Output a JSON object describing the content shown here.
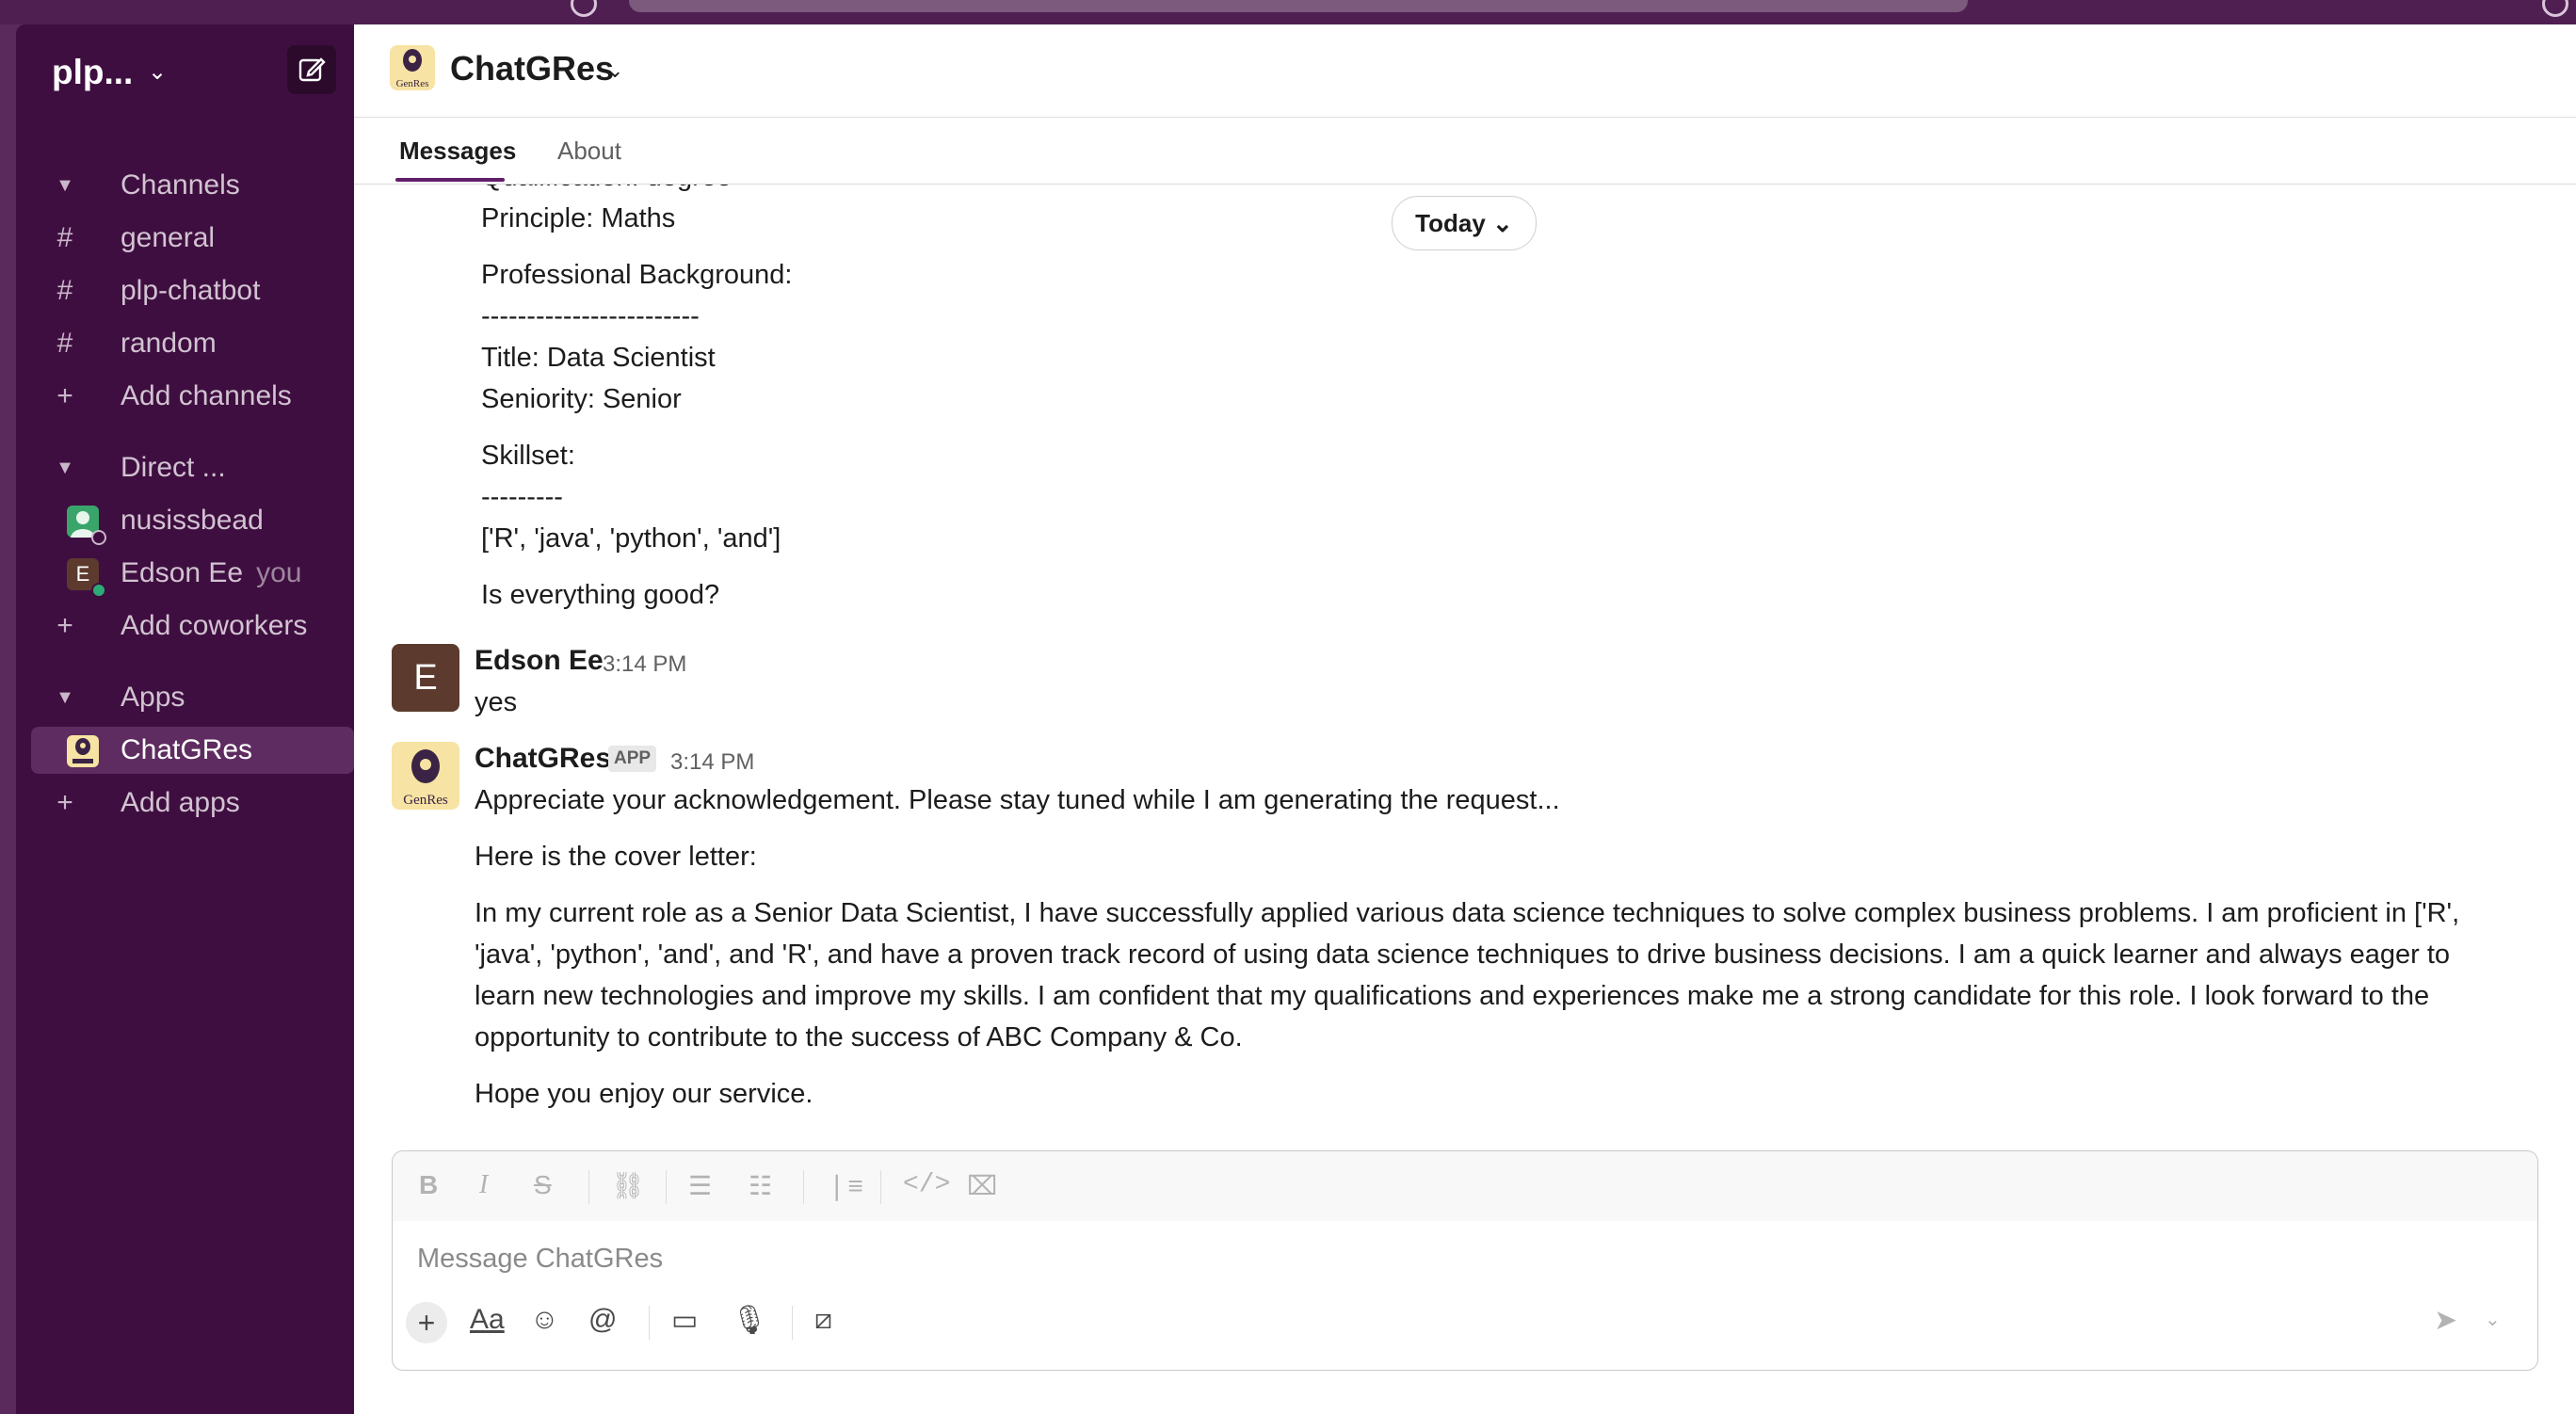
{
  "workspace": {
    "name": "plp..."
  },
  "sidebar": {
    "channels_header": "Channels",
    "channels": [
      "general",
      "plp-chatbot",
      "random"
    ],
    "add_channels": "Add channels",
    "dms_header": "Direct ...",
    "dms": [
      {
        "name": "nusissbead",
        "suffix": ""
      },
      {
        "name": "Edson Ee",
        "suffix": "you",
        "initial": "E"
      }
    ],
    "add_coworkers": "Add coworkers",
    "apps_header": "Apps",
    "apps": [
      "ChatGRes"
    ],
    "add_apps": "Add apps"
  },
  "header": {
    "title": "ChatGRes",
    "logo_text": "GenRes"
  },
  "tabs": [
    "Messages",
    "About"
  ],
  "date_divider": "Today",
  "thread_top": {
    "lines": [
      "Qualification: degree",
      "Principle: Maths",
      "Professional Background:",
      "------------------------",
      "Title: Data Scientist",
      "Seniority: Senior",
      "Skillset:",
      "---------",
      "['R', 'java', 'python', 'and']",
      "Is everything good?"
    ]
  },
  "messages": [
    {
      "author": "Edson Ee",
      "avatar_initial": "E",
      "time": "3:14 PM",
      "text": "yes"
    },
    {
      "author": "ChatGRes",
      "badge": "APP",
      "time": "3:14 PM",
      "paragraphs": [
        "Appreciate your acknowledgement. Please stay tuned while I am generating the request...",
        "Here is the cover letter:",
        "In my current role as a Senior Data Scientist, I have successfully applied various data science techniques to solve complex business problems. I am proficient in ['R', 'java', 'python', 'and', and 'R', and have a proven track record of using data science techniques to drive business decisions. I am a quick learner and always eager to learn new technologies and improve my skills. I am confident that my qualifications and experiences make me a strong candidate for this role. I look forward to the opportunity to contribute to the success of ABC Company & Co.",
        "Hope you enjoy our service."
      ]
    }
  ],
  "composer": {
    "placeholder": "Message ChatGRes",
    "format_label": "Aa"
  },
  "colors": {
    "sidebar": "#3f0e40",
    "active": "#5e2c60",
    "accent": "#611f69",
    "chrome": "#4f1f52"
  }
}
